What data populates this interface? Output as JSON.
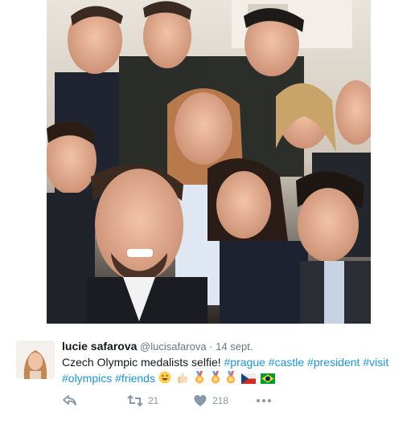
{
  "tweet": {
    "author_name": "lucie safarova",
    "handle": "@lucisafarova",
    "separator": "·",
    "date": "14 sept.",
    "text_plain": "Czech Olympic medalists selfie!",
    "hashtags_line1": [
      "#prague",
      "#castle",
      "#president",
      "#visit"
    ],
    "hashtags_line2": [
      "#olympics",
      "#friends"
    ],
    "emojis": [
      "grinning-face",
      "thumbs-up",
      "medal",
      "medal",
      "medal",
      "czech-flag",
      "brazil-flag"
    ]
  },
  "actions": {
    "reply_icon": "reply-icon",
    "retweet_icon": "retweet-icon",
    "retweet_count": "21",
    "like_icon": "heart-icon",
    "like_count": "218",
    "more_icon": "more-icon"
  },
  "colors": {
    "link": "#1b95e0",
    "meta": "#657786",
    "action": "#8899a6"
  }
}
